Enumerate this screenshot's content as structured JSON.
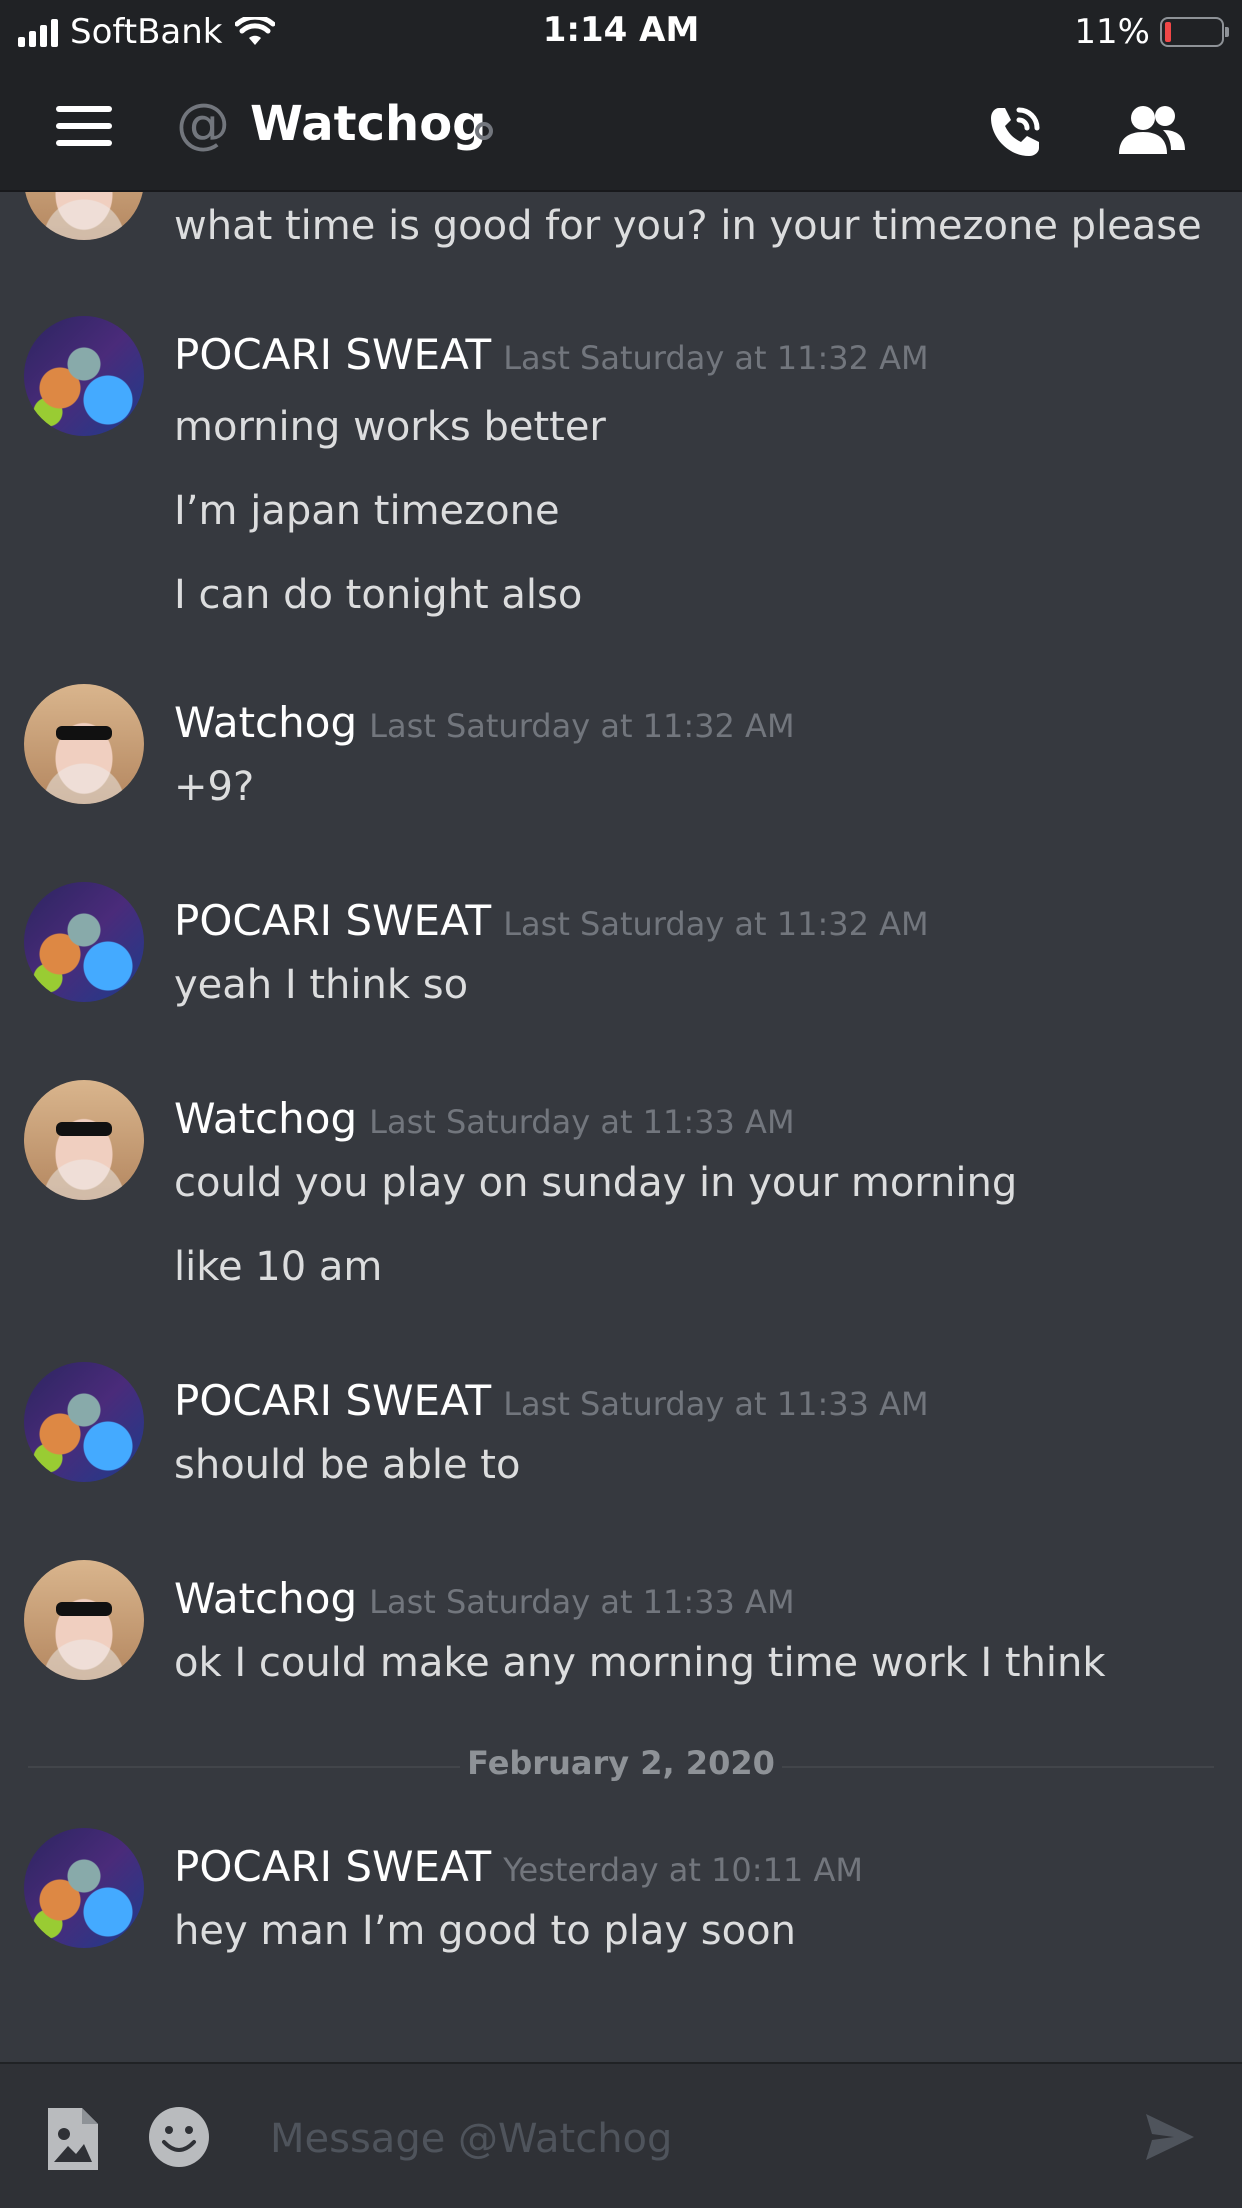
{
  "status_bar": {
    "carrier": "SoftBank",
    "time": "1:14 AM",
    "battery": "11%",
    "battery_level": 0.11
  },
  "header": {
    "at": "@",
    "title": "Watchog"
  },
  "messages": [
    {
      "author": "",
      "time": "",
      "lines": [
        "what time is good for you? in your timezone please"
      ]
    },
    {
      "author": "POCARI SWEAT",
      "time": "Last Saturday at 11:32 AM",
      "lines": [
        "morning works better",
        "I’m japan timezone",
        "I can do tonight also"
      ]
    },
    {
      "author": "Watchog",
      "time": "Last Saturday at 11:32 AM",
      "lines": [
        "+9?"
      ]
    },
    {
      "author": "POCARI SWEAT",
      "time": "Last Saturday at 11:32 AM",
      "lines": [
        "yeah I think so"
      ]
    },
    {
      "author": "Watchog",
      "time": "Last Saturday at 11:33 AM",
      "lines": [
        "could you play on sunday in your morning",
        "like 10 am"
      ]
    },
    {
      "author": "POCARI SWEAT",
      "time": "Last Saturday at 11:33 AM",
      "lines": [
        "should be able to"
      ]
    },
    {
      "author": "Watchog",
      "time": "Last Saturday at 11:33 AM",
      "lines": [
        "ok I could make any morning time work I think"
      ]
    },
    {
      "author": "POCARI SWEAT",
      "time": "Yesterday at 10:11 AM",
      "lines": [
        "hey man I’m good to play soon"
      ]
    }
  ],
  "date_divider": "February 2, 2020",
  "input": {
    "placeholder": "Message @Watchog"
  },
  "colors": {
    "background": "#36393f",
    "header": "#202225",
    "input_bar": "#2f3136",
    "muted_text": "#72767d",
    "battery_low": "#f04747"
  }
}
